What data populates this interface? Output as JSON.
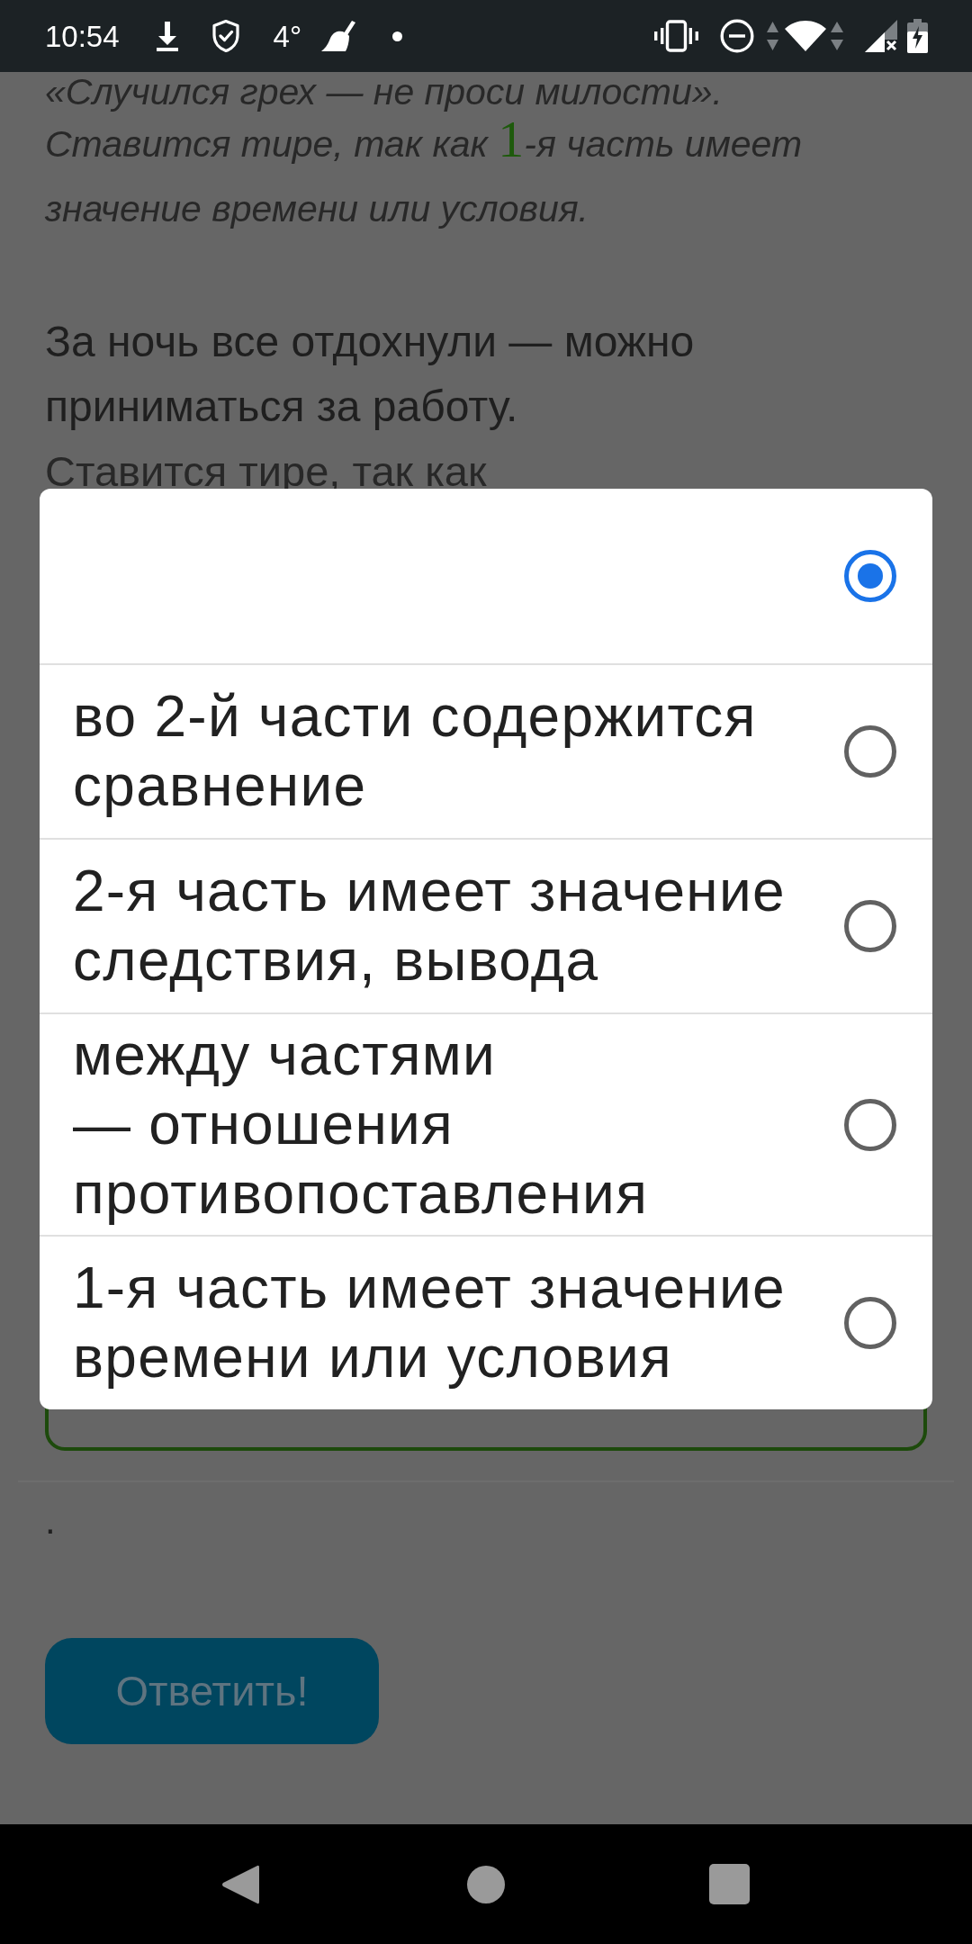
{
  "status_bar": {
    "time": "10:54",
    "temperature": "4°"
  },
  "page": {
    "example_tail": "«Случился грех — не проси милости».",
    "explanation": {
      "before": "Ставится тире, так как ",
      "highlight": "1",
      "after": "-я часть имеет значение времени или условия."
    },
    "sentence": "За ночь все отдохнули — можно приниматься за работу.",
    "explanation_2": "Ставится тире, так как",
    "note": ".",
    "submit_button": "Ответить!"
  },
  "dialog": {
    "options": [
      {
        "selected": true
      },
      {
        "label": "во 2-й части содержится сравнение",
        "selected": false
      },
      {
        "label": "2-я часть имеет значение следствия, вывода",
        "selected": false
      },
      {
        "label": "между частями — отношения противопоставления",
        "selected": false
      },
      {
        "label": "1-я часть имеет значение времени или условия",
        "selected": false
      }
    ]
  }
}
